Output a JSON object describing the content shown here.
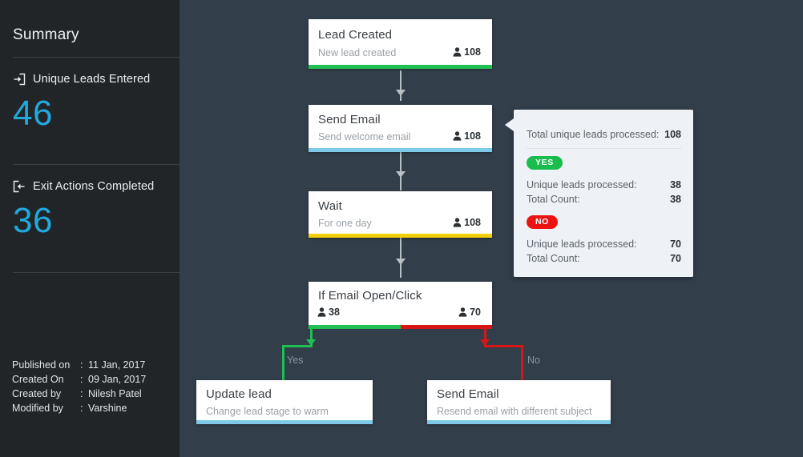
{
  "sidebar": {
    "title": "Summary",
    "metrics": [
      {
        "icon": "enter-arrow-icon",
        "label": "Unique Leads Entered",
        "value": "46"
      },
      {
        "icon": "exit-arrow-icon",
        "label": "Exit Actions Completed",
        "value": "36"
      }
    ],
    "meta": [
      {
        "key": "Published on",
        "sep": ":",
        "value": "11 Jan, 2017"
      },
      {
        "key": "Created On",
        "sep": ":",
        "value": "09 Jan, 2017"
      },
      {
        "key": "Created by",
        "sep": ":",
        "value": "Nilesh Patel"
      },
      {
        "key": "Modified by",
        "sep": ":",
        "value": "Varshine"
      }
    ]
  },
  "flow": {
    "nodes": [
      {
        "id": "lead-created",
        "title": "Lead Created",
        "subtitle": "New lead created",
        "count": "108",
        "accent": "#1fbf53"
      },
      {
        "id": "send-email",
        "title": "Send Email",
        "subtitle": "Send welcome email",
        "count": "108",
        "accent": "#7ec9e8"
      },
      {
        "id": "wait",
        "title": "Wait",
        "subtitle": "For one day",
        "count": "108",
        "accent": "#f2cf0a"
      },
      {
        "id": "if-email-open-click",
        "title": "If Email Open/Click",
        "count_yes": "38",
        "count_no": "70",
        "accent_yes": "#1fbf53",
        "accent_no": "#d81616"
      },
      {
        "id": "update-lead",
        "title": "Update lead",
        "subtitle": "Change lead stage to warm",
        "accent": "#7ec9e8"
      },
      {
        "id": "send-email-resend",
        "title": "Send Email",
        "subtitle": "Resend email with different subject",
        "accent": "#7ec9e8"
      }
    ],
    "branch_labels": {
      "yes": "Yes",
      "no": "No"
    }
  },
  "popover": {
    "total_label": "Total unique leads processed:",
    "total_value": "108",
    "groups": [
      {
        "badge": "YES",
        "badge_color": "#18bd4d",
        "lines": [
          {
            "label": "Unique leads processed:",
            "value": "38"
          },
          {
            "label": "Total Count:",
            "value": "38"
          }
        ]
      },
      {
        "badge": "NO",
        "badge_color": "#ec1313",
        "lines": [
          {
            "label": "Unique leads processed:",
            "value": "70"
          },
          {
            "label": "Total Count:",
            "value": "70"
          }
        ]
      }
    ]
  },
  "colors": {
    "sidebar_bg": "#212528",
    "canvas_bg": "#323f4b",
    "accent_blue": "#21a8dd",
    "green": "#1fbf53",
    "red": "#d81616",
    "yellow": "#f2cf0a",
    "light_blue": "#7ec9e8",
    "connector_gray": "#b8c0c6"
  }
}
